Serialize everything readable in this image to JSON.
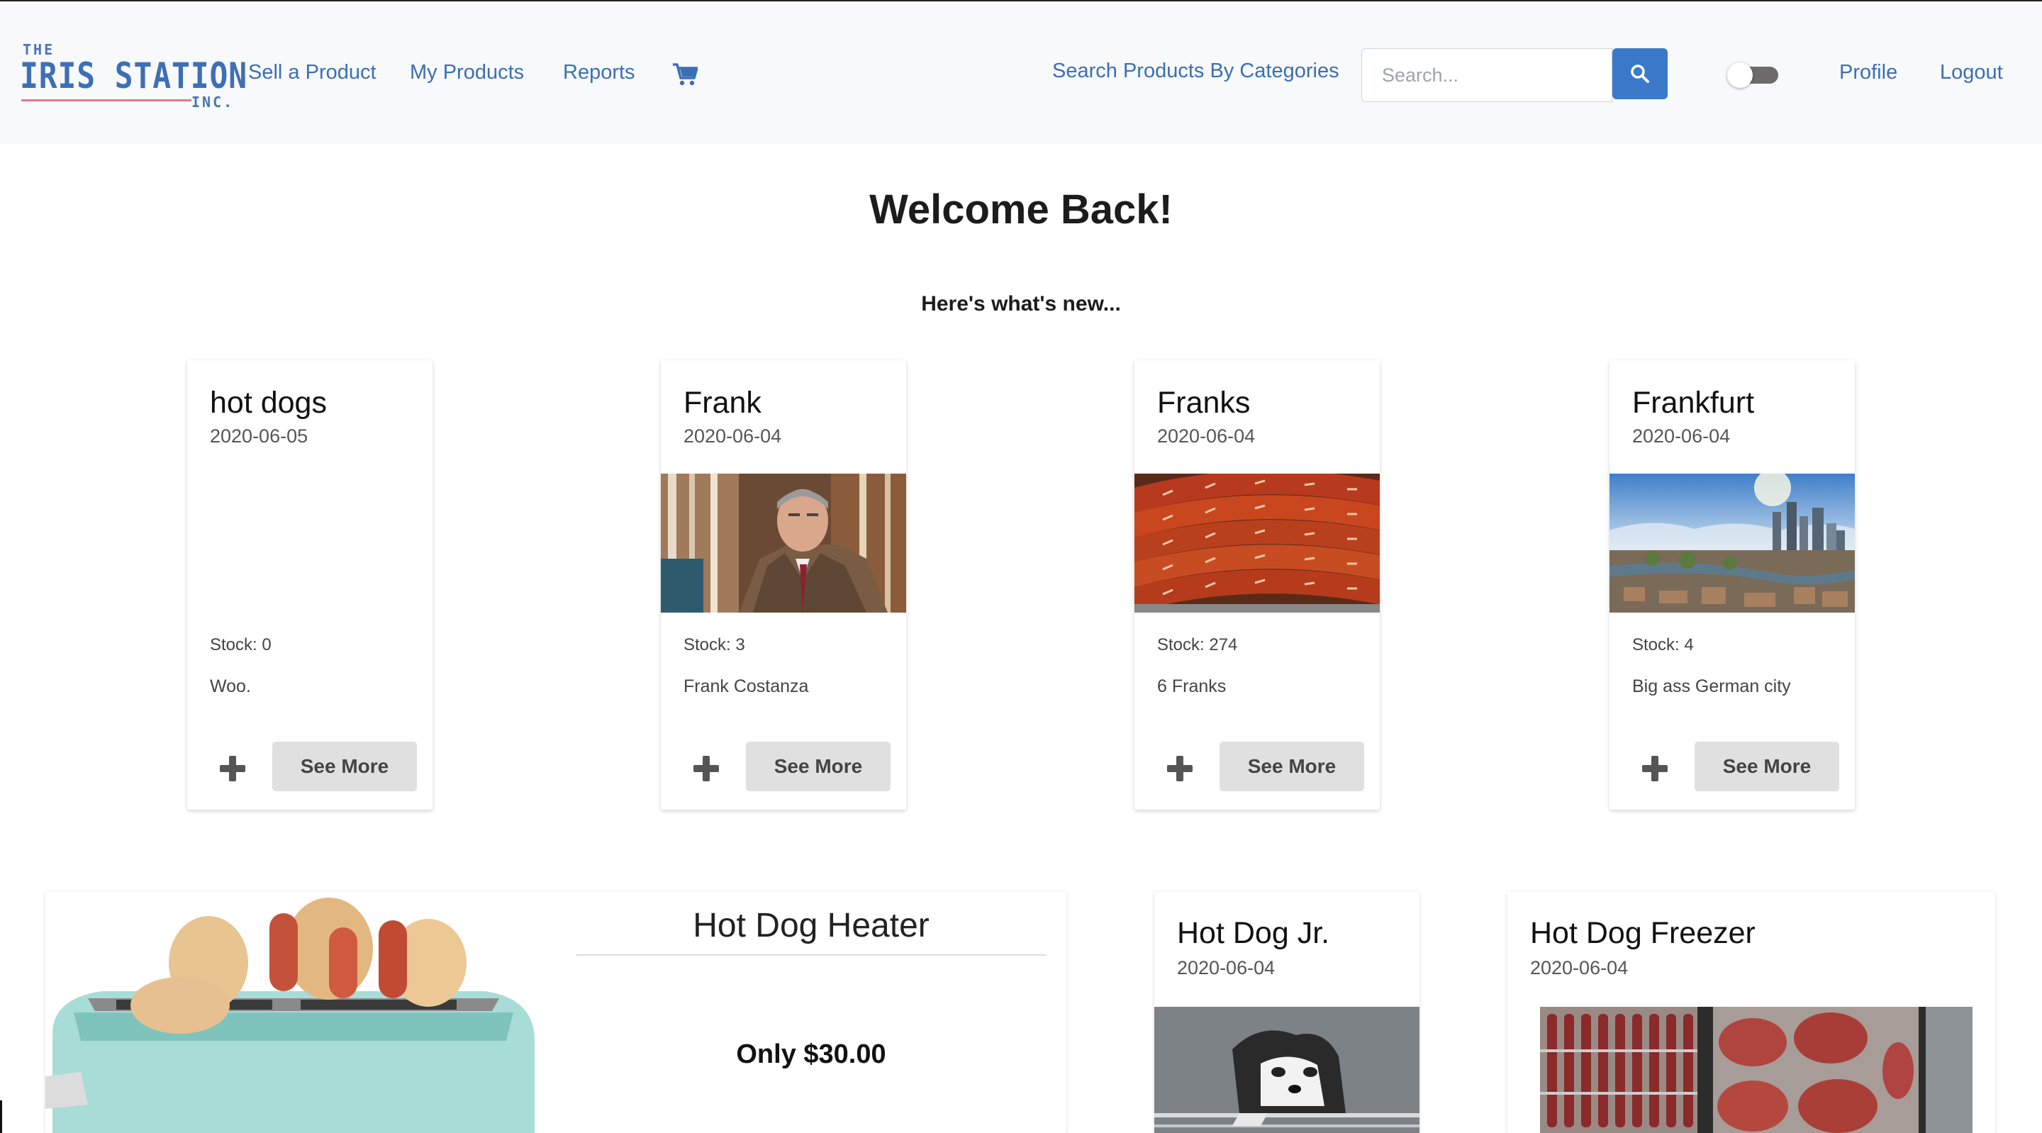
{
  "nav": {
    "logo": {
      "the": "THE",
      "name": "IRIS STATION",
      "inc": "INC."
    },
    "links": [
      "Sell a Product",
      "My Products",
      "Reports"
    ],
    "search_categories": "Search Products By Categories",
    "search_placeholder": "Search...",
    "profile": "Profile",
    "logout": "Logout",
    "dark_mode_toggle": "off",
    "colors": {
      "link": "#3a6fb5",
      "search_button": "#3a79c9"
    }
  },
  "main": {
    "welcome": "Welcome Back!",
    "subheading": "Here's what's new..."
  },
  "cards": [
    {
      "title": "hot dogs",
      "date": "2020-06-05",
      "stock": "Stock: 0",
      "description": "Woo.",
      "button": "See More",
      "image": "none"
    },
    {
      "title": "Frank",
      "date": "2020-06-04",
      "stock": "Stock: 3",
      "description": "Frank Costanza",
      "button": "See More",
      "image": "man-in-plaid-jacket"
    },
    {
      "title": "Franks",
      "date": "2020-06-04",
      "stock": "Stock: 274",
      "description": "6 Franks",
      "button": "See More",
      "image": "grilled-sausages"
    },
    {
      "title": "Frankfurt",
      "date": "2020-06-04",
      "stock": "Stock: 4",
      "description": "Big ass German city",
      "button": "See More",
      "image": "city-skyline"
    }
  ],
  "featured": {
    "title": "Hot Dog Heater",
    "price": "Only $30.00",
    "image": "hot-dog-toaster"
  },
  "bottom_cards": [
    {
      "title": "Hot Dog Jr.",
      "date": "2020-06-04",
      "image": "husky-puppy-in-fridge"
    },
    {
      "title": "Hot Dog Freezer",
      "date": "2020-06-04",
      "image": "meat-freezer"
    }
  ]
}
